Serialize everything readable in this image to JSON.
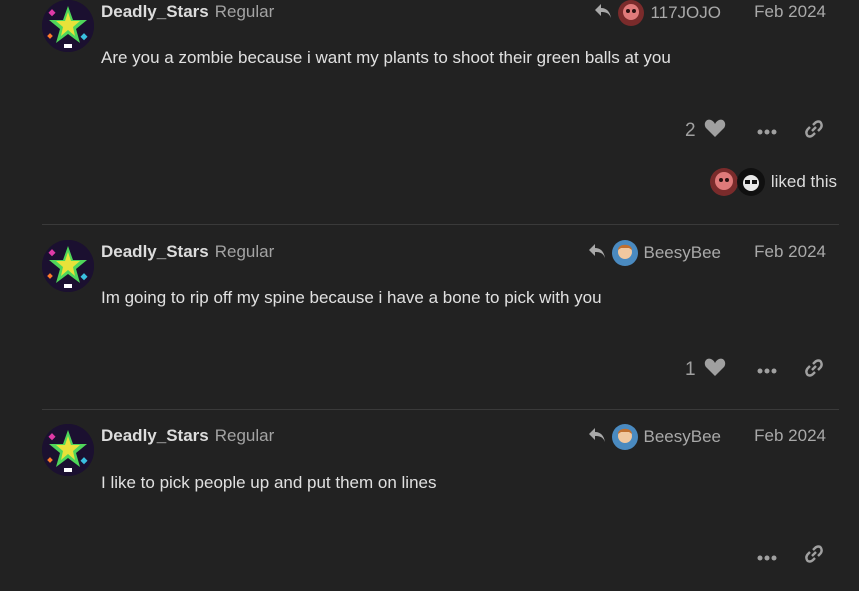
{
  "posts": [
    {
      "username": "Deadly_Stars",
      "user_title": "Regular",
      "reply_to": "117JOJO",
      "date": "Feb 2024",
      "body": "Are you a zombie because i want my plants to shoot their green balls at you",
      "like_count": "2",
      "liked_by_text": "liked this"
    },
    {
      "username": "Deadly_Stars",
      "user_title": "Regular",
      "reply_to": "BeesyBee",
      "date": "Feb 2024",
      "body": "Im going to rip off my spine because i have a bone to pick with you",
      "like_count": "1"
    },
    {
      "username": "Deadly_Stars",
      "user_title": "Regular",
      "reply_to": "BeesyBee",
      "date": "Feb 2024",
      "body": "I like to pick people up and put them on lines"
    }
  ],
  "icons": {
    "reply": "reply-arrow-icon",
    "heart": "heart-icon",
    "more": "ellipsis-icon",
    "share": "link-icon"
  },
  "colors": {
    "background": "#222222",
    "text": "#dddddd",
    "muted": "#a9a9a9"
  }
}
